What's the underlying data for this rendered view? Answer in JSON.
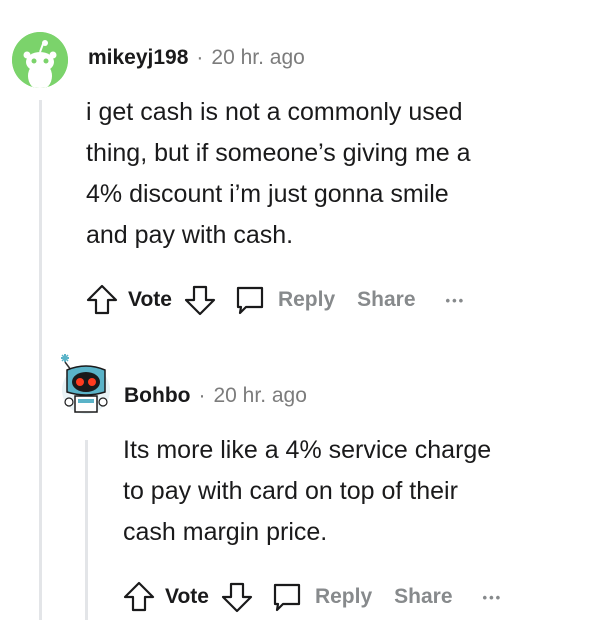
{
  "comments": [
    {
      "author": "mikeyj198",
      "separator": "·",
      "time": "20 hr. ago",
      "body_lines": [
        "i get cash is not a commonly used",
        "thing, but if someone’s giving me a",
        "4% discount i’m just gonna smile",
        "and pay with cash."
      ],
      "actions": {
        "vote": "Vote",
        "reply": "Reply",
        "share": "Share",
        "more": "•••"
      },
      "avatar_color": "#7bd36b"
    },
    {
      "author": "Bohbo",
      "separator": "·",
      "time": "20 hr. ago",
      "body_lines": [
        "Its more like a 4% service charge",
        "to pay with card on top of their",
        "cash margin price."
      ],
      "actions": {
        "vote": "Vote",
        "reply": "Reply",
        "share": "Share",
        "more": "•••"
      },
      "avatar_color": "#5ab3c8"
    }
  ],
  "colors": {
    "text": "#1a1a1b",
    "muted": "#7c7c7c",
    "thread_line": "#e3e5e8"
  }
}
